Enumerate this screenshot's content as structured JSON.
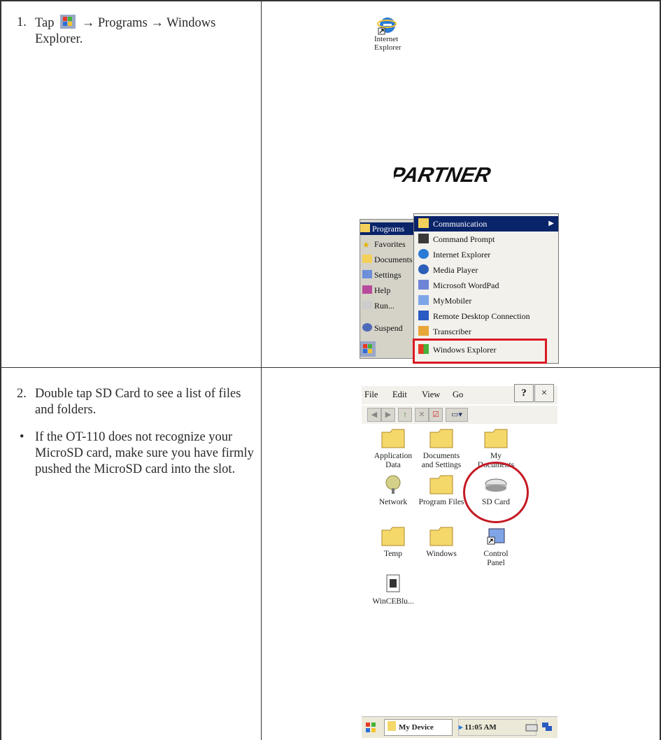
{
  "rows": [
    {
      "step_number": "1.",
      "text_before": "Tap",
      "text_after": "→ Programs → Windows Explorer."
    },
    {
      "step_number": "2.",
      "text": "Double tap SD Card to see a list of files and folders.",
      "bullet": "•",
      "bullet_text": "If the OT-110 does not recognize your MicroSD card, make sure you have firmly pushed the MicroSD card into the slot."
    }
  ],
  "screen1": {
    "desktop_icon": "Internet Explorer",
    "logo": "PARTNER",
    "start_menu": [
      "Programs",
      "Favorites",
      "Documents",
      "Settings",
      "Help",
      "Run...",
      "Suspend"
    ],
    "programs_menu": [
      "Communication",
      "Command Prompt",
      "Internet Explorer",
      "Media Player",
      "Microsoft WordPad",
      "MyMobiler",
      "Remote Desktop Connection",
      "Transcriber",
      "Windows Explorer"
    ]
  },
  "screen2": {
    "menus": [
      "File",
      "Edit",
      "View",
      "Go"
    ],
    "help_label": "?",
    "close_label": "×",
    "items": [
      {
        "label1": "Application",
        "label2": "Data",
        "icon": "folder-icon"
      },
      {
        "label1": "Documents",
        "label2": "and Settings",
        "icon": "folder-icon"
      },
      {
        "label1": "My",
        "label2": "Documents",
        "icon": "folder-icon"
      },
      {
        "label1": "Network",
        "label2": "",
        "icon": "network-icon"
      },
      {
        "label1": "Program Files",
        "label2": "",
        "icon": "folder-icon"
      },
      {
        "label1": "SD Card",
        "label2": "",
        "icon": "sd-card-icon"
      },
      {
        "label1": "Temp",
        "label2": "",
        "icon": "folder-icon"
      },
      {
        "label1": "Windows",
        "label2": "",
        "icon": "folder-icon"
      },
      {
        "label1": "Control",
        "label2": "Panel",
        "icon": "control-panel-icon"
      },
      {
        "label1": "WinCEBlu...",
        "label2": "",
        "icon": "app-icon"
      }
    ],
    "taskbar_device": "My Device",
    "clock": "11:05 AM"
  },
  "colors": {
    "highlight": "#0a246a",
    "annotation_red": "#d91a24",
    "folder": "#f4d86a"
  }
}
